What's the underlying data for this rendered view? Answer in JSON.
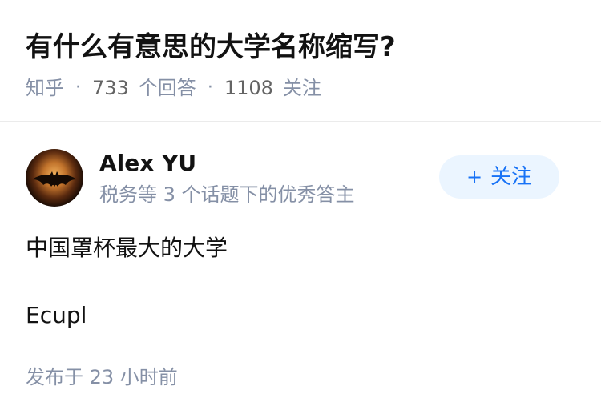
{
  "question": {
    "title": "有什么有意思的大学名称缩写?",
    "site": "知乎",
    "answer_count": "733",
    "answer_label": "个回答",
    "follower_count": "1108",
    "follower_label": "关注",
    "separator": "·"
  },
  "answer": {
    "author_name": "Alex YU",
    "author_bio": "税务等 3 个话题下的优秀答主",
    "follow_label": "关注",
    "follow_icon": "+",
    "content_lines": [
      "中国罩杯最大的大学",
      "Ecupl"
    ],
    "time": "发布于 23 小时前",
    "avatar_icon": "bat-symbol-icon"
  },
  "colors": {
    "accent": "#1772f6",
    "accent_bg": "#ebf5ff",
    "muted": "#8590a6",
    "text": "#121212"
  }
}
